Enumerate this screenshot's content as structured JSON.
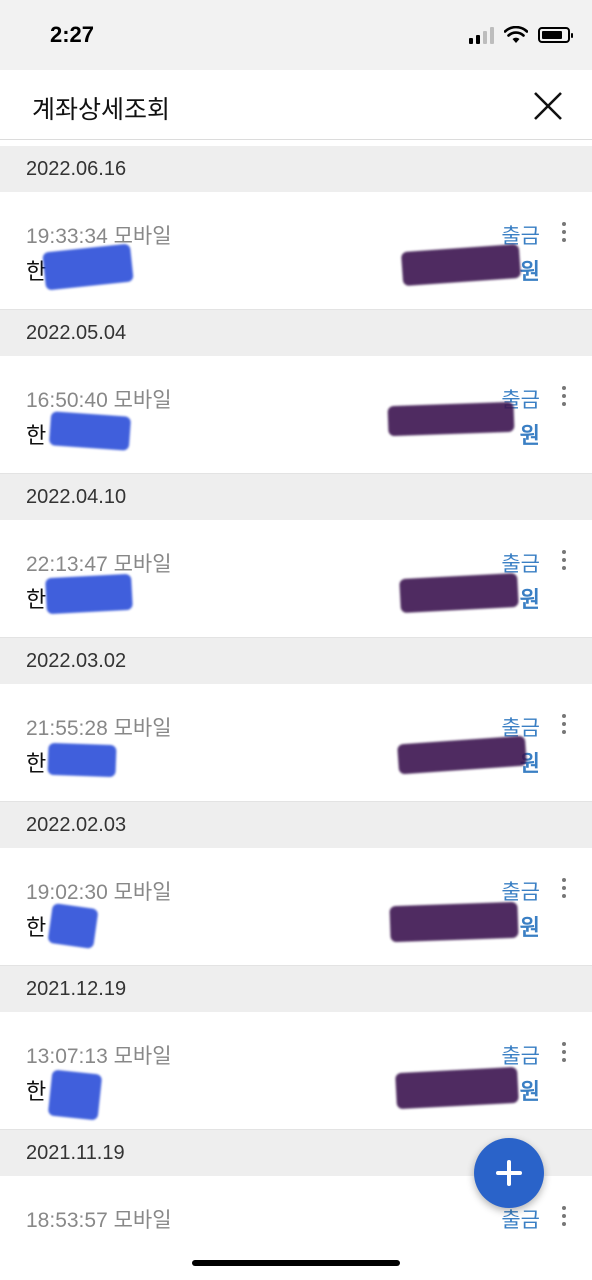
{
  "status": {
    "time": "2:27"
  },
  "header": {
    "title": "계좌상세조회"
  },
  "colors": {
    "accent": "#3a7fc4",
    "fab": "#2a63c9",
    "date_bg": "#eeeeee"
  },
  "groups": [
    {
      "date": "2022.06.16",
      "time": "19:33:34 모바일",
      "name": "한",
      "type": "출금",
      "amount": "원"
    },
    {
      "date": "2022.05.04",
      "time": "16:50:40 모바일",
      "name": "한",
      "type": "출금",
      "amount": "원"
    },
    {
      "date": "2022.04.10",
      "time": "22:13:47 모바일",
      "name": "한",
      "type": "출금",
      "amount": "원"
    },
    {
      "date": "2022.03.02",
      "time": "21:55:28 모바일",
      "name": "한",
      "type": "출금",
      "amount": "원"
    },
    {
      "date": "2022.02.03",
      "time": "19:02:30 모바일",
      "name": "한",
      "type": "출금",
      "amount": "원"
    },
    {
      "date": "2021.12.19",
      "time": "13:07:13 모바일",
      "name": "한",
      "type": "출금",
      "amount": "원"
    },
    {
      "date": "2021.11.19",
      "time": "18:53:57 모바일",
      "name": "",
      "type": "출금",
      "amount": ""
    }
  ],
  "icons": {
    "close": "close-icon",
    "more": "more-vertical-icon",
    "add": "plus-icon",
    "signal": "signal-icon",
    "wifi": "wifi-icon",
    "battery": "battery-icon"
  }
}
